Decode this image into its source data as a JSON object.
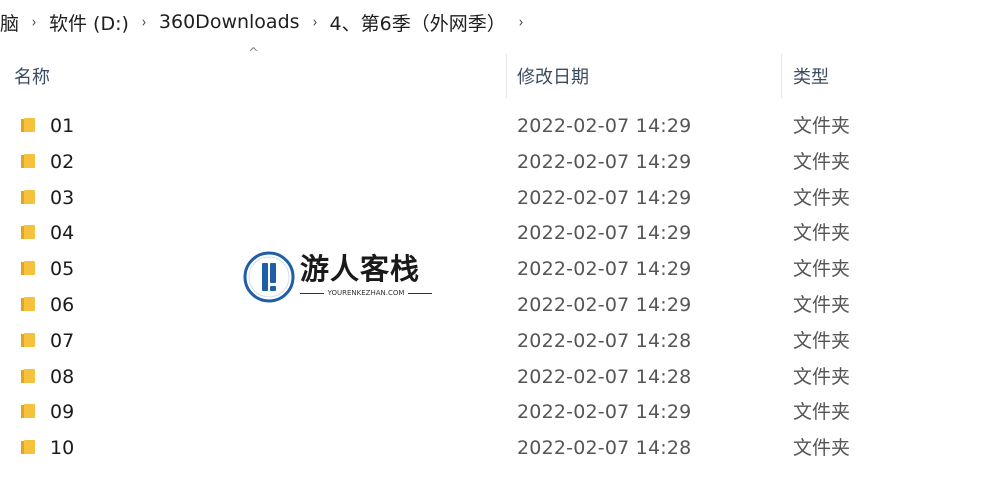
{
  "breadcrumb": {
    "items": [
      "脑",
      "软件 (D:)",
      "360Downloads",
      "4、第6季（外网季）"
    ],
    "separator": "›"
  },
  "header": {
    "name_label": "名称",
    "modified_label": "修改日期",
    "type_label": "类型",
    "sort_indicator": "^"
  },
  "rows": [
    {
      "name": "01",
      "modified": "2022-02-07 14:29",
      "type": "文件夹"
    },
    {
      "name": "02",
      "modified": "2022-02-07 14:29",
      "type": "文件夹"
    },
    {
      "name": "03",
      "modified": "2022-02-07 14:29",
      "type": "文件夹"
    },
    {
      "name": "04",
      "modified": "2022-02-07 14:29",
      "type": "文件夹"
    },
    {
      "name": "05",
      "modified": "2022-02-07 14:29",
      "type": "文件夹"
    },
    {
      "name": "06",
      "modified": "2022-02-07 14:29",
      "type": "文件夹"
    },
    {
      "name": "07",
      "modified": "2022-02-07 14:28",
      "type": "文件夹"
    },
    {
      "name": "08",
      "modified": "2022-02-07 14:28",
      "type": "文件夹"
    },
    {
      "name": "09",
      "modified": "2022-02-07 14:29",
      "type": "文件夹"
    },
    {
      "name": "10",
      "modified": "2022-02-07 14:28",
      "type": "文件夹"
    }
  ],
  "watermark": {
    "title": "游人客栈",
    "subtitle": "YOURENKEZHAN.COM"
  },
  "colors": {
    "folder_yellow": "#f6c13c",
    "folder_dark": "#e0a623",
    "header_text": "#3b4c61",
    "logo_blue": "#1f5fa8"
  },
  "icons": {
    "folder": "folder-icon",
    "separator": "chevron-right-icon"
  }
}
